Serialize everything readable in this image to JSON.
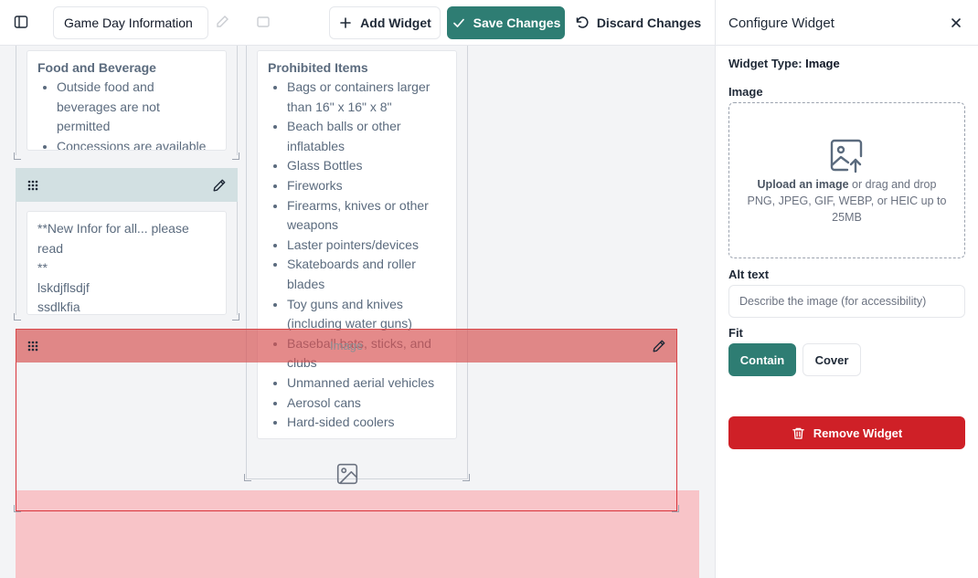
{
  "toolbar": {
    "title_value": "Game Day Information",
    "add_widget_label": "Add Widget",
    "save_label": "Save Changes",
    "discard_label": "Discard Changes"
  },
  "canvas": {
    "food_card": {
      "heading": "Food and Beverage",
      "items": [
        "Outside food and beverages are not permitted",
        "Concessions are available"
      ]
    },
    "notes_card": {
      "lines": [
        "**New Infor for all... please read",
        "**",
        "lskdjflsdjf",
        "ssdlkfia"
      ]
    },
    "prohibited_card": {
      "heading": "Prohibited Items",
      "items": [
        "Bags or containers larger than 16\" x 16\" x 8\"",
        "Beach balls or other inflatables",
        "Glass Bottles",
        "Fireworks",
        "Firearms, knives or other weapons",
        "Laster pointers/devices",
        "Skateboards and roller blades",
        "Toy guns and knives (including water guns)",
        "Baseball bats, sticks, and clubs",
        "Unmanned aerial vehicles",
        "Aerosol cans",
        "Hard-sided coolers"
      ]
    },
    "selected_widget_label": "Image"
  },
  "panel": {
    "title": "Configure Widget",
    "widget_type_label": "Widget Type:",
    "widget_type_value": "Image",
    "image_label": "Image",
    "upload_strong": "Upload an image",
    "upload_rest": " or drag and drop",
    "upload_hint_1": "PNG, JPEG, GIF, WEBP, or HEIC up to",
    "upload_hint_2": "25MB",
    "alt_label": "Alt text",
    "alt_placeholder": "Describe the image (for accessibility)",
    "fit_label": "Fit",
    "fit_options": [
      "Contain",
      "Cover"
    ],
    "fit_selected": "Contain",
    "remove_label": "Remove Widget"
  },
  "colors": {
    "accent": "#2e7d73",
    "danger": "#cf2027",
    "selection": "#d9333b",
    "drop_zone": "#f8c4c8",
    "widget_header": "#d2e0e2"
  }
}
